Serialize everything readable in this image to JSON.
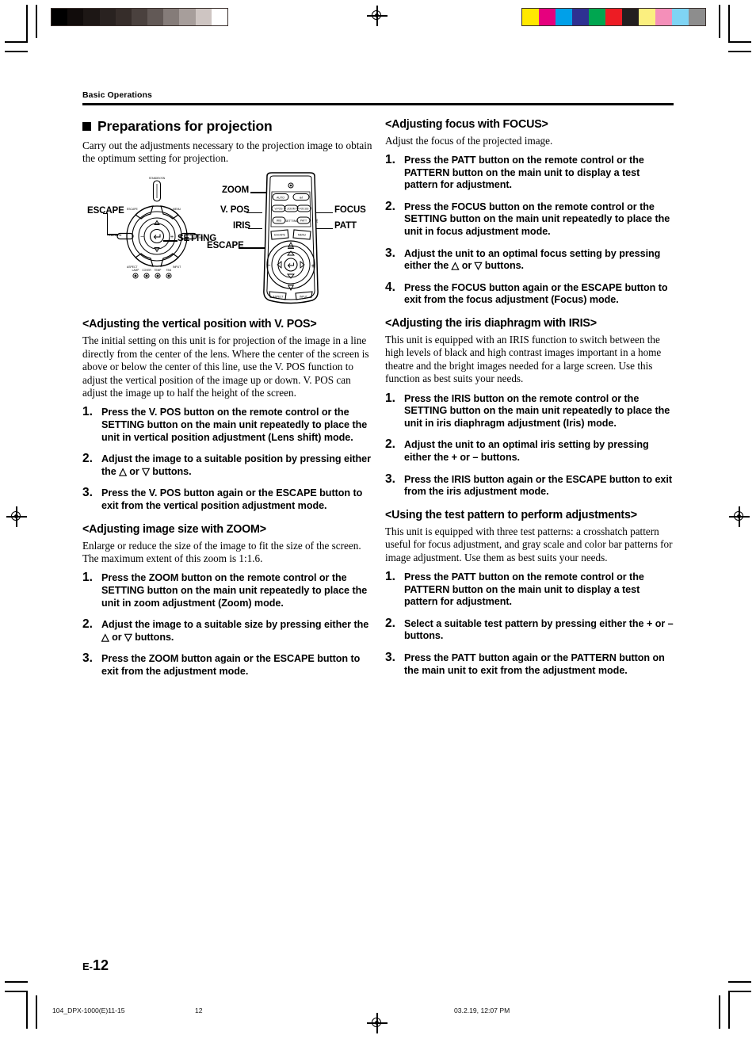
{
  "running_head": "Basic Operations",
  "section": {
    "title": "Preparations for projection",
    "intro": "Carry out the adjustments necessary to the projection image to obtain the optimum setting for projection."
  },
  "figure": {
    "main_unit": {
      "standby_on_label": "STANDBY/ON",
      "callout_escape": "ESCAPE",
      "callout_setting": "SETTING",
      "panel_keys": [
        "ESCAPE",
        "MENU",
        "PATTERN",
        "SETTING",
        "ASPECT",
        "INPUT"
      ],
      "indicators": [
        "LAMP",
        "COVER",
        "TEMP",
        "FAN"
      ],
      "nav_plus": "+",
      "nav_minus": "–"
    },
    "remote": {
      "callout_zoom": "ZOOM",
      "callout_vpos": "V. POS",
      "callout_iris": "IRIS",
      "callout_escape": "ESCAPE",
      "callout_focus": "FOCUS",
      "callout_patt": "PATT",
      "keys_row1": [
        "AUTO",
        "⏻/I"
      ],
      "keys_row2": [
        "V.POS",
        "ZOOM",
        "FOCUS"
      ],
      "keys_row3": [
        "IRIS",
        "PATT"
      ],
      "setting_label": "SETTING",
      "keys_row4": [
        "ESCAPE",
        "MENU"
      ],
      "keys_row5": [
        "ASPECT",
        "INPUT"
      ],
      "nav_plus": "+",
      "nav_minus": "–"
    }
  },
  "left_column": {
    "vpos": {
      "heading": "<Adjusting the vertical position with V. POS>",
      "body": "The initial setting on this unit is for projection of the image in a line directly from the center of the lens. Where the center of the screen is above or below the center of this line, use the V. POS function to adjust the vertical position of the image up or down. V. POS can adjust the image up to half the height of the screen.",
      "steps": [
        {
          "num": "1.",
          "text": "Press the V. POS button on the remote control or the SETTING button on the main unit repeatedly to place the unit in vertical position adjustment (Lens shift) mode."
        },
        {
          "num": "2.",
          "text": "Adjust the image to a suitable position by pressing either the △ or ▽ buttons."
        },
        {
          "num": "3.",
          "text": "Press the V. POS button again or the ESCAPE button to exit from the vertical position adjustment mode."
        }
      ]
    },
    "zoom": {
      "heading": "<Adjusting image size with ZOOM>",
      "body": "Enlarge or reduce the size of the image to fit the size of the screen. The maximum extent of this zoom is 1:1.6.",
      "steps": [
        {
          "num": "1.",
          "text": "Press the ZOOM button on the remote control or the SETTING button on the main unit repeatedly to place the unit in zoom adjustment (Zoom) mode."
        },
        {
          "num": "2.",
          "text": "Adjust the image to a suitable size by pressing either the △ or ▽ buttons."
        },
        {
          "num": "3.",
          "text": "Press the ZOOM button again or the ESCAPE button to exit from the adjustment mode."
        }
      ]
    }
  },
  "right_column": {
    "focus": {
      "heading": "<Adjusting focus with FOCUS>",
      "body": "Adjust the focus of the projected image.",
      "steps": [
        {
          "num": "1.",
          "text": "Press the PATT button on the remote control or the PATTERN button on the main unit to display a test pattern for adjustment."
        },
        {
          "num": "2.",
          "text": "Press the FOCUS button on the remote control or the SETTING button on the main unit repeatedly to place the unit in focus adjustment mode."
        },
        {
          "num": "3.",
          "text": "Adjust the unit to an optimal focus setting by pressing either the △ or ▽ buttons."
        },
        {
          "num": "4.",
          "text": "Press the FOCUS button again or the ESCAPE button to exit from the focus adjustment (Focus) mode."
        }
      ]
    },
    "iris": {
      "heading": "<Adjusting the iris diaphragm with IRIS>",
      "body": "This unit is equipped with an IRIS function to switch between the high levels of black and high contrast images important in a home theatre and the bright images needed for a large screen. Use this function as best suits your needs.",
      "steps": [
        {
          "num": "1.",
          "text": "Press the IRIS button on the remote control or the SETTING button on the main unit repeatedly to place the unit in iris diaphragm adjustment (Iris) mode."
        },
        {
          "num": "2.",
          "text": "Adjust the unit to an optimal iris setting by pressing either the + or – buttons."
        },
        {
          "num": "3.",
          "text": "Press the IRIS button again or the ESCAPE button to exit from the iris adjustment mode."
        }
      ]
    },
    "testpattern": {
      "heading": "<Using the test pattern to perform adjustments>",
      "body": "This unit is equipped with three test patterns: a crosshatch pattern useful for focus adjustment, and gray scale and color bar patterns for image adjustment. Use them as best suits your needs.",
      "steps": [
        {
          "num": "1.",
          "text": "Press the PATT button on the remote control or the PATTERN button on the main unit to display a test pattern for adjustment."
        },
        {
          "num": "2.",
          "text": "Select a suitable test pattern by pressing either the + or – buttons."
        },
        {
          "num": "3.",
          "text": "Press the PATT button again or the PATTERN button on the main unit to exit from the adjustment mode."
        }
      ]
    }
  },
  "folio": {
    "prefix": "E-",
    "number": "12"
  },
  "print_slug": {
    "filename": "104_DPX-1000(E)11-15",
    "page": "12",
    "timestamp": "03.2.19, 12:07 PM"
  },
  "calibration": {
    "grayscale": [
      "#000000",
      "#110c0b",
      "#1d1715",
      "#292220",
      "#362d2a",
      "#4a413e",
      "#625956",
      "#857c79",
      "#a79e9b",
      "#cec5c2",
      "#ffffff"
    ],
    "colorbar": [
      "#ffe800",
      "#e6007e",
      "#00a0e9",
      "#2e3192",
      "#00a650",
      "#ed1c24",
      "#231f20",
      "#fbef7f",
      "#f48fb9",
      "#7fd4f4",
      "#8d8d8d"
    ]
  }
}
